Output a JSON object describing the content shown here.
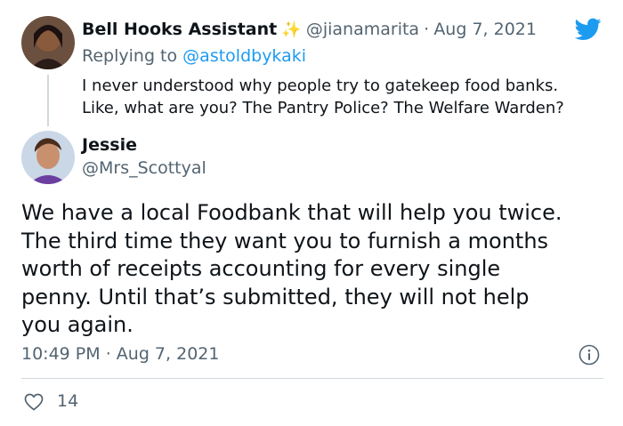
{
  "reply_tweet": {
    "display_name": "Bell Hooks Assistant",
    "sparkle": "✨",
    "handle": "@jianamarita",
    "separator": "·",
    "date": "Aug 7, 2021",
    "replying_prefix": "Replying to",
    "replying_handle": "@astoldbykaki",
    "text_line1": "I never understood why people try to gatekeep food banks.",
    "text_line2": "Like, what are you? The Pantry Police? The Welfare Warden?"
  },
  "main_tweet": {
    "display_name": "Jessie",
    "handle": "@Mrs_Scottyal",
    "text_lines": [
      "We have a local Foodbank that will help you twice.",
      "The third time they want you to furnish a months",
      "worth of receipts accounting for every single",
      "penny. Until that’s submitted, they will not help",
      "you again."
    ],
    "time": "10:49 PM",
    "separator": "·",
    "date": "Aug 7, 2021",
    "like_count": "14"
  },
  "colors": {
    "twitter_blue": "#1d9bf0",
    "text": "#0f1419",
    "secondary": "#536471",
    "divider": "#cfd9de"
  },
  "icons": [
    "twitter-bird-icon",
    "info-icon",
    "heart-icon",
    "sparkle-icon"
  ]
}
